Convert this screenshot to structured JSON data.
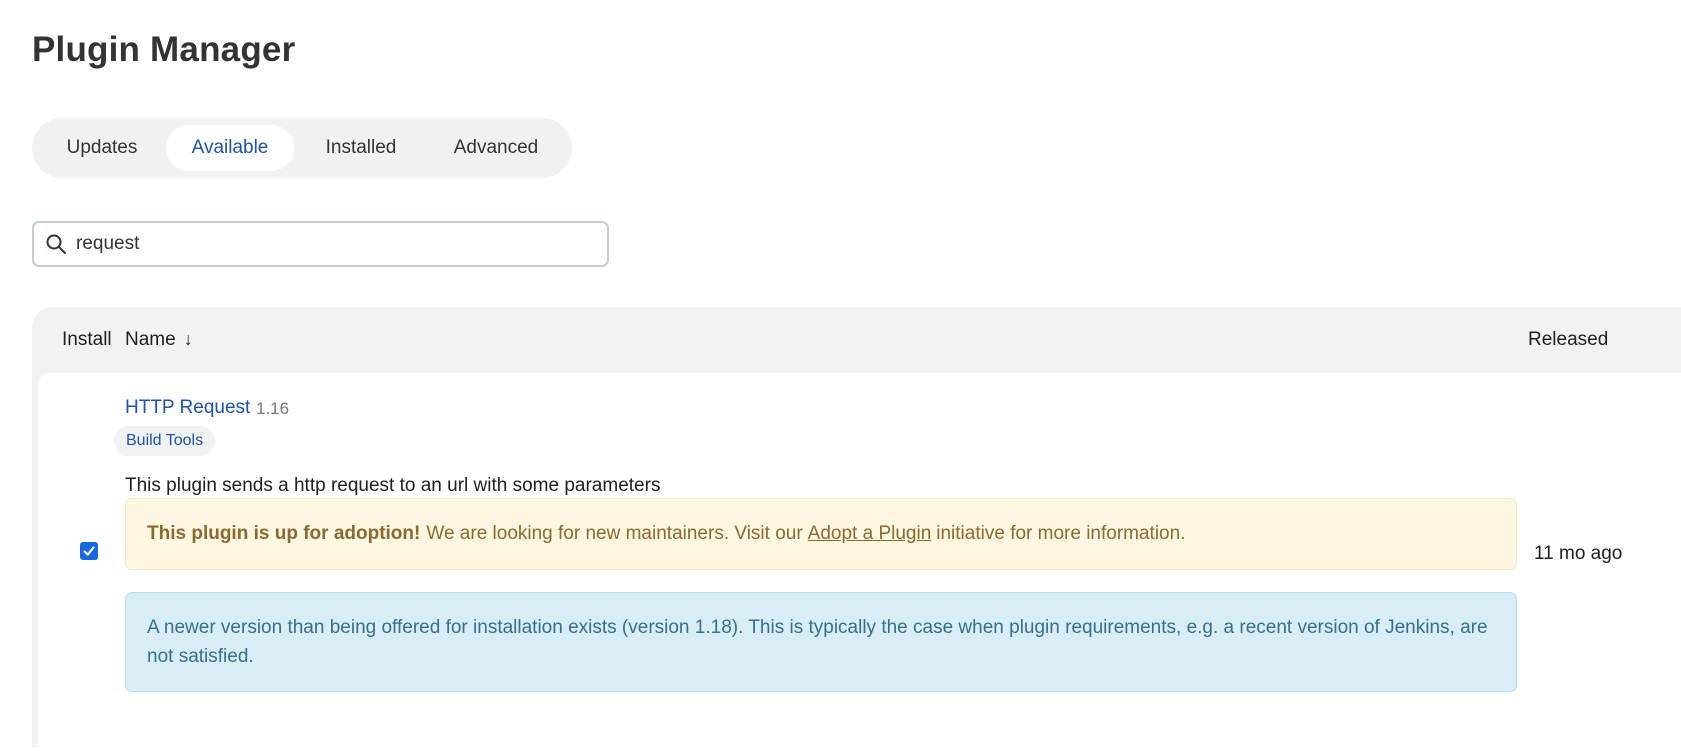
{
  "page": {
    "title": "Plugin Manager"
  },
  "tabs": [
    {
      "label": "Updates",
      "active": false
    },
    {
      "label": "Available",
      "active": true
    },
    {
      "label": "Installed",
      "active": false
    },
    {
      "label": "Advanced",
      "active": false
    }
  ],
  "search": {
    "value": "request",
    "icon": "search-icon"
  },
  "table": {
    "columns": {
      "install": "Install",
      "name": "Name",
      "sort_indicator": "↓",
      "released": "Released"
    },
    "rows": [
      {
        "name": "HTTP Request",
        "version": "1.16",
        "category": "Build Tools",
        "excerpt": "This plugin sends a http request to an url with some parameters",
        "checked": true,
        "released": "11 mo ago",
        "adoption": {
          "bold": "This plugin is up for adoption!",
          "before_link": "We are looking for new maintainers. Visit our",
          "link": "Adopt a Plugin",
          "after_link": "initiative for more information."
        },
        "newer_version_notice": "A newer version than being offered for installation exists (version 1.18). This is typically the case when plugin requirements, e.g. a recent version of Jenkins, are not satisfied."
      }
    ]
  },
  "colors": {
    "accent": "#1d52b0",
    "checkbox": "#1668dc",
    "warning_bg": "#fdf7e2",
    "warning_text": "#8a6a2e",
    "info_bg": "#d8edf6",
    "info_text": "#35708c"
  }
}
